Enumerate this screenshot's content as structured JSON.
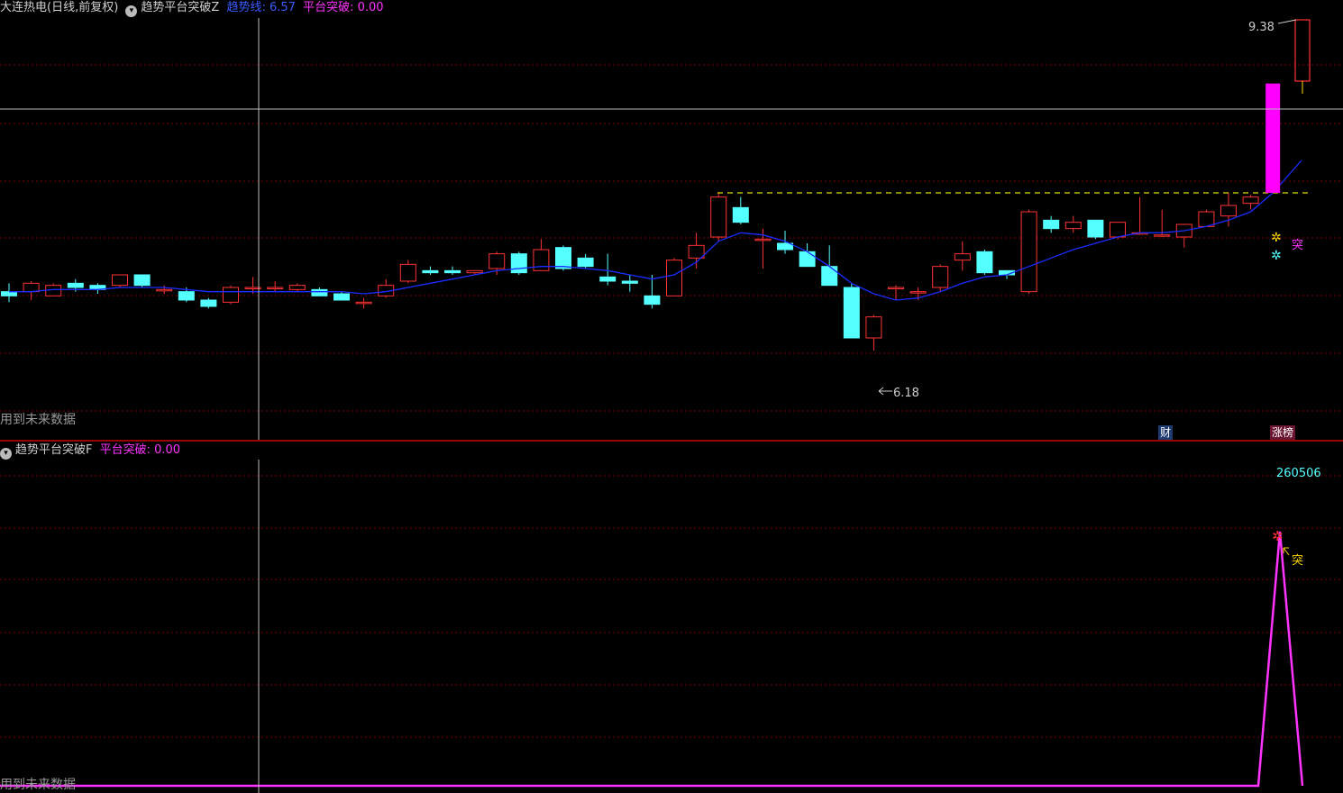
{
  "top_panel": {
    "stock_name": "大连热电(日线,前复权)",
    "indicator_name": "趋势平台突破Z",
    "trend_label": "趋势线: 6.57",
    "breakout_label": "平台突破: 0.00",
    "max_price_label": "9.38",
    "min_price_label": "6.18",
    "breakout_marker": "突",
    "warning": "用到未来数据",
    "badge_fin": "财",
    "badge_limit": "涨榜",
    "colors": {
      "up": "#ff3333",
      "down": "#54ffff",
      "trend": "#1a2cff",
      "platform": "#e0e000",
      "limit_up": "#ff00ff"
    }
  },
  "bottom_panel": {
    "indicator_name": "趋势平台突破F",
    "breakout_label": "平台突破: 0.00",
    "date_label": "260506",
    "breakout_marker": "突",
    "warning": "用到未来数据"
  },
  "chart_data": {
    "type": "candlestick",
    "ohlc": [
      [
        6.6,
        6.58,
        6.64,
        6.55
      ],
      [
        6.6,
        6.64,
        6.65,
        6.56
      ],
      [
        6.58,
        6.63,
        6.64,
        6.58
      ],
      [
        6.64,
        6.62,
        6.66,
        6.6
      ],
      [
        6.63,
        6.61,
        6.64,
        6.59
      ],
      [
        6.63,
        6.68,
        6.68,
        6.62
      ],
      [
        6.68,
        6.63,
        6.68,
        6.62
      ],
      [
        6.61,
        6.61,
        6.63,
        6.59
      ],
      [
        6.6,
        6.56,
        6.62,
        6.55
      ],
      [
        6.56,
        6.53,
        6.57,
        6.52
      ],
      [
        6.55,
        6.62,
        6.63,
        6.54
      ],
      [
        6.62,
        6.62,
        6.67,
        6.59
      ],
      [
        6.62,
        6.62,
        6.65,
        6.6
      ],
      [
        6.61,
        6.63,
        6.64,
        6.6
      ],
      [
        6.61,
        6.58,
        6.62,
        6.58
      ],
      [
        6.59,
        6.56,
        6.6,
        6.56
      ],
      [
        6.55,
        6.55,
        6.57,
        6.52
      ],
      [
        6.58,
        6.63,
        6.66,
        6.57
      ],
      [
        6.65,
        6.73,
        6.75,
        6.64
      ],
      [
        6.7,
        6.69,
        6.72,
        6.68
      ],
      [
        6.7,
        6.69,
        6.72,
        6.68
      ],
      [
        6.69,
        6.7,
        6.7,
        6.68
      ],
      [
        6.71,
        6.78,
        6.79,
        6.68
      ],
      [
        6.78,
        6.69,
        6.79,
        6.68
      ],
      [
        6.7,
        6.8,
        6.85,
        6.7
      ],
      [
        6.81,
        6.71,
        6.82,
        6.7
      ],
      [
        6.76,
        6.72,
        6.78,
        6.71
      ],
      [
        6.67,
        6.65,
        6.78,
        6.63
      ],
      [
        6.65,
        6.64,
        6.68,
        6.6
      ],
      [
        6.58,
        6.54,
        6.68,
        6.52
      ],
      [
        6.58,
        6.75,
        6.76,
        6.58
      ],
      [
        6.76,
        6.82,
        6.88,
        6.71
      ],
      [
        6.86,
        7.05,
        7.07,
        6.84
      ],
      [
        7.0,
        6.93,
        7.05,
        6.92
      ],
      [
        6.85,
        6.85,
        6.9,
        6.71
      ],
      [
        6.83,
        6.8,
        6.89,
        6.78
      ],
      [
        6.79,
        6.72,
        6.83,
        6.72
      ],
      [
        6.72,
        6.63,
        6.82,
        6.63
      ],
      [
        6.62,
        6.38,
        6.64,
        6.38
      ],
      [
        6.38,
        6.48,
        6.49,
        6.32
      ],
      [
        6.62,
        6.62,
        6.63,
        6.56
      ],
      [
        6.6,
        6.6,
        6.62,
        6.56
      ],
      [
        6.62,
        6.72,
        6.73,
        6.6
      ],
      [
        6.75,
        6.78,
        6.84,
        6.7
      ],
      [
        6.79,
        6.69,
        6.8,
        6.68
      ],
      [
        6.7,
        6.68,
        6.7,
        6.66
      ],
      [
        6.6,
        6.98,
        6.99,
        6.59
      ],
      [
        6.94,
        6.9,
        6.96,
        6.88
      ],
      [
        6.9,
        6.93,
        6.96,
        6.88
      ],
      [
        6.94,
        6.86,
        6.94,
        6.85
      ],
      [
        6.86,
        6.93,
        6.93,
        6.85
      ],
      [
        6.88,
        6.88,
        7.05,
        6.87
      ],
      [
        6.87,
        6.87,
        6.99,
        6.86
      ],
      [
        6.86,
        6.92,
        6.92,
        6.81
      ],
      [
        6.91,
        6.98,
        6.99,
        6.91
      ],
      [
        6.96,
        7.01,
        7.07,
        6.91
      ],
      [
        7.02,
        7.05,
        7.06,
        6.99
      ],
      [
        7.07,
        7.59,
        7.59,
        7.07
      ]
    ],
    "trend_line": [
      6.6,
      6.6,
      6.61,
      6.61,
      6.61,
      6.62,
      6.62,
      6.62,
      6.61,
      6.6,
      6.6,
      6.6,
      6.6,
      6.6,
      6.6,
      6.6,
      6.59,
      6.6,
      6.62,
      6.64,
      6.66,
      6.68,
      6.7,
      6.71,
      6.72,
      6.72,
      6.71,
      6.7,
      6.68,
      6.66,
      6.68,
      6.74,
      6.84,
      6.88,
      6.87,
      6.84,
      6.79,
      6.72,
      6.64,
      6.59,
      6.56,
      6.57,
      6.6,
      6.64,
      6.67,
      6.68,
      6.72,
      6.76,
      6.8,
      6.83,
      6.86,
      6.88,
      6.88,
      6.89,
      6.91,
      6.94,
      6.98,
      7.07
    ],
    "platform_level": 7.07,
    "y_range": [
      6.05,
      7.85
    ],
    "breakout_signal": [
      0,
      0,
      0,
      0,
      0,
      0,
      0,
      0,
      0,
      0,
      0,
      0,
      0,
      0,
      0,
      0,
      0,
      0,
      0,
      0,
      0,
      0,
      0,
      0,
      0,
      0,
      0,
      0,
      0,
      0,
      0,
      0,
      0,
      0,
      0,
      0,
      0,
      0,
      0,
      0,
      0,
      0,
      0,
      0,
      0,
      0,
      0,
      0,
      0,
      0,
      0,
      0,
      0,
      0,
      0,
      0,
      0,
      1
    ]
  }
}
